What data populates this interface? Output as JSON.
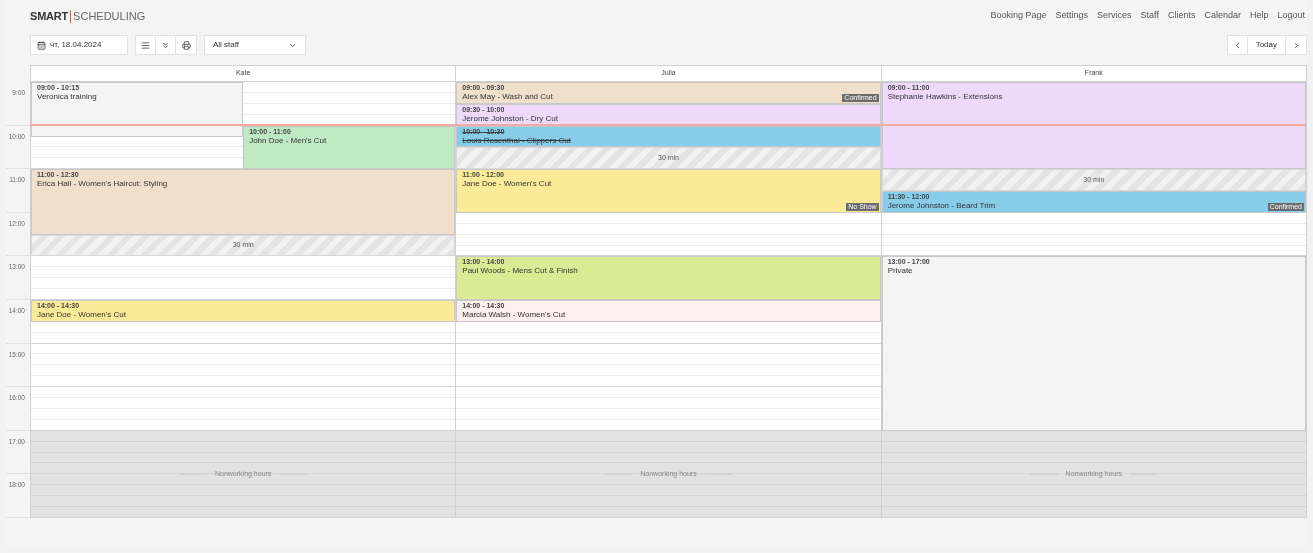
{
  "logo": {
    "strong": "SMART",
    "light": "SCHEDULING"
  },
  "nav": [
    "Booking Page",
    "Settings",
    "Services",
    "Staff",
    "Clients",
    "Calendar",
    "Help",
    "Logout"
  ],
  "toolbar": {
    "date": "чт, 18.04.2024",
    "staff_select": "All staff",
    "today": "Today"
  },
  "hours": [
    {
      "label": "9:00",
      "kind": "working"
    },
    {
      "label": "10:00",
      "kind": "working"
    },
    {
      "label": "11:00",
      "kind": "working"
    },
    {
      "label": "12:00",
      "kind": "working"
    },
    {
      "label": "13:00",
      "kind": "working"
    },
    {
      "label": "14:00",
      "kind": "working"
    },
    {
      "label": "15:00",
      "kind": "working"
    },
    {
      "label": "16:00",
      "kind": "working"
    },
    {
      "label": "17:00",
      "kind": "nonworking"
    },
    {
      "label": "18:00",
      "kind": "nonworking"
    }
  ],
  "columns": [
    {
      "name": "Kate",
      "nonworking_label": "Nonworking hours",
      "events": [
        {
          "time": "09:00 - 10:15",
          "title": "Veronica training",
          "color": "#f4f4f4",
          "cancelled": false
        },
        {
          "time": "10:00 - 11:00",
          "title": "John Doe - Men's Cut",
          "color": "#bfe9c2",
          "cancelled": false
        },
        {
          "time": "11:00 - 12:30",
          "title": "Erica Hall - Women's Haircut: Styling",
          "color": "#f0dfcb",
          "cancelled": false,
          "buffer": "30 min"
        },
        {
          "time": "14:00 - 14:30",
          "title": "Jane Doe - Women's Cut",
          "color": "#fbeb98",
          "cancelled": false
        }
      ]
    },
    {
      "name": "Julia",
      "nonworking_label": "Nonworking hours",
      "events": [
        {
          "time": "09:00 - 09:30",
          "title": "Alex May - Wash and Cut",
          "color": "#f0dfcb",
          "cancelled": false,
          "status": "Confirmed"
        },
        {
          "time": "09:30 - 10:00",
          "title": "Jerome Johnston - Dry Cut",
          "color": "#eed9fb",
          "cancelled": false
        },
        {
          "time": "10:00 - 10:30",
          "title": "Louis Rosenthal - Clippers Cut",
          "color": "#87cce9",
          "cancelled": true,
          "buffer": "30 min"
        },
        {
          "time": "11:00 - 12:00",
          "title": "Jane Doe - Women's Cut",
          "color": "#fbeb98",
          "cancelled": false,
          "status": "No Show"
        },
        {
          "time": "13:00 - 14:00",
          "title": "Paul Woods - Mens Cut & Finish",
          "color": "#dbeb94",
          "cancelled": false
        },
        {
          "time": "14:00 - 14:30",
          "title": "Marcia Walsh - Women's Cut",
          "color": "#fdeef0",
          "cancelled": false
        }
      ]
    },
    {
      "name": "Frank",
      "nonworking_label": "Nonworking hours",
      "events": [
        {
          "time": "09:00 - 11:00",
          "title": "Stephanie Hawkins - Extensions",
          "color": "#eed9fb",
          "cancelled": false,
          "buffer": "30 min"
        },
        {
          "time": "11:30 - 12:00",
          "title": "Jerome Johnston - Beard Trim",
          "color": "#87cce9",
          "cancelled": false,
          "status": "Confirmed"
        },
        {
          "time": "13:00 - 17:00",
          "title": "Private",
          "color": "#f4f4f4",
          "cancelled": false
        }
      ]
    }
  ]
}
